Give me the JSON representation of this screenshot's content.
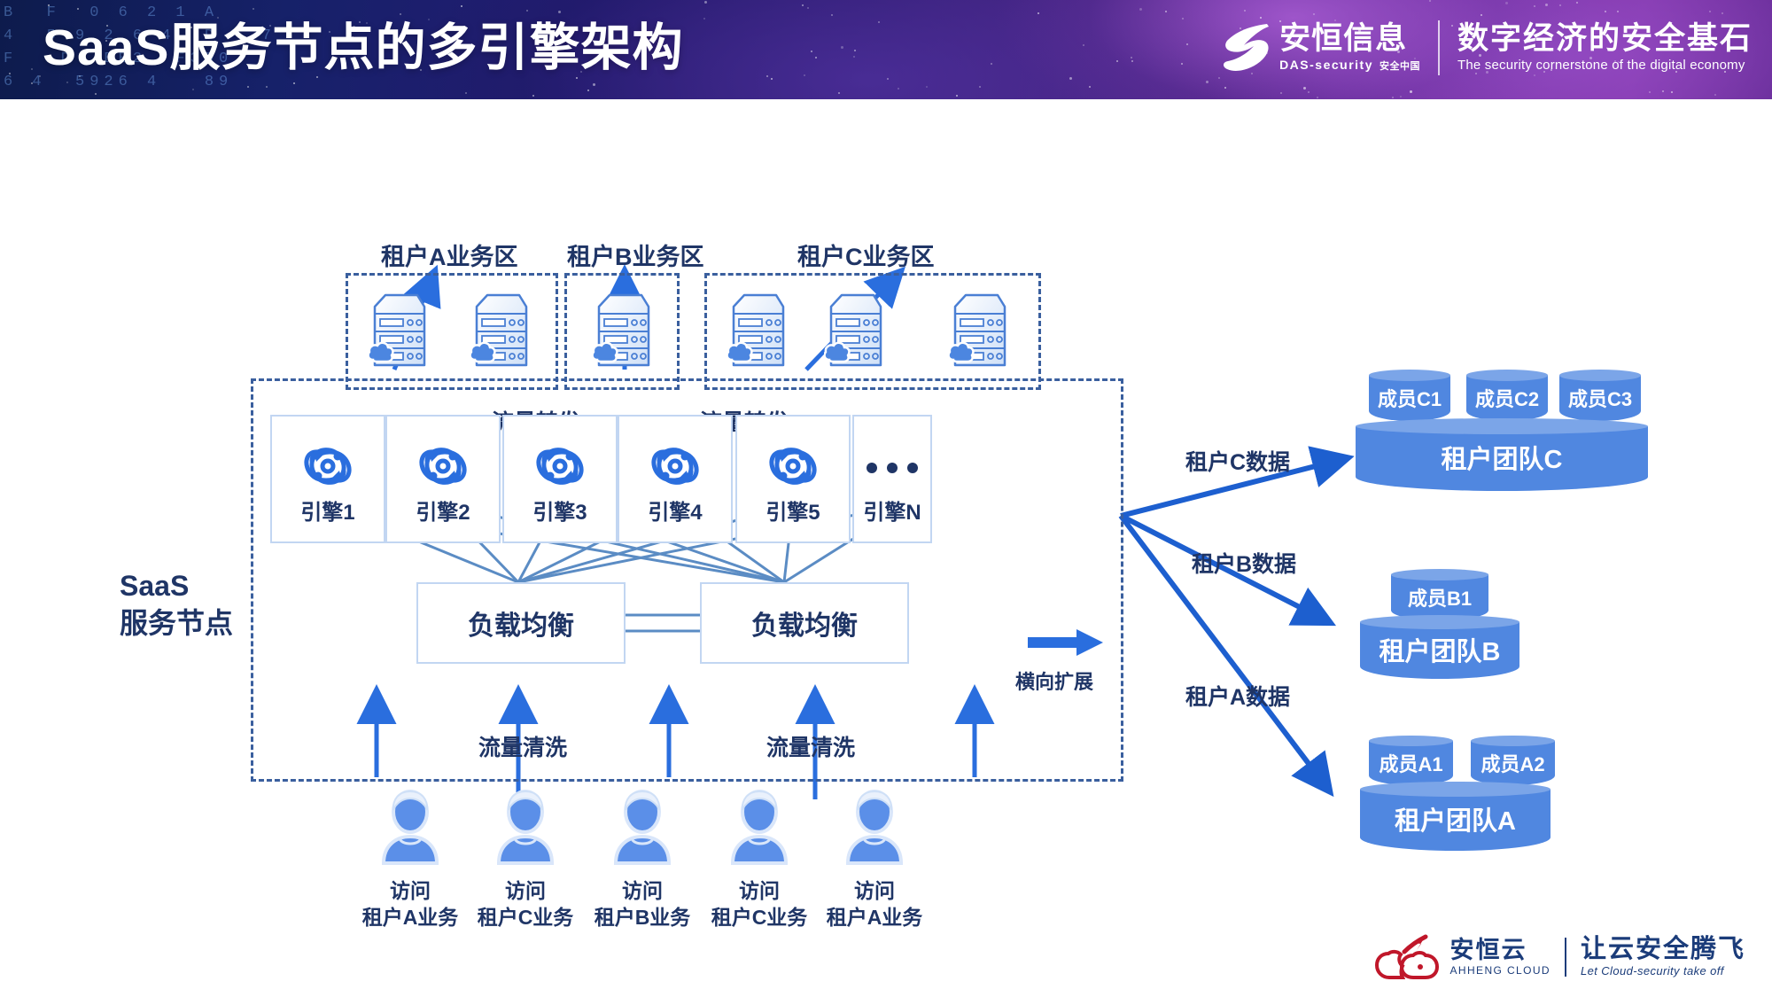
{
  "header": {
    "title": "SaaS服务节点的多引擎架构",
    "code_texts": "B  F  0 6 2 1 A\n4  5 9 2 6 4  D   7\nF   D  BE2  F3D0\n6 4  5926 4   89",
    "brand": {
      "name_cn": "安恒信息",
      "name_en": "DAS-security",
      "name_en_cn": "安全中国",
      "slogan_cn": "数字经济的安全基石",
      "slogan_en": "The security cornerstone of the digital economy"
    },
    "colors": {
      "bg_start": "#0d1b4c",
      "bg_end": "#8e3cb4",
      "title": "#ffffff"
    }
  },
  "diagram": {
    "colors": {
      "navy_text": "#1f3566",
      "arrow_blue": "#2a6ede",
      "engine_icon": "#2a6ede",
      "box_border": "#c2d6f2",
      "dash_border": "#3a5f9e",
      "cylinder_body": "#5087e0",
      "cylinder_top": "#7ba5e8",
      "wire": "#5b8cc4"
    },
    "saas_label_line1": "SaaS",
    "saas_label_line2": "服务节点",
    "tenant_zones": [
      {
        "title": "租户A业务区",
        "servers": 2
      },
      {
        "title": "租户B业务区",
        "servers": 1
      },
      {
        "title": "租户C业务区",
        "servers": 3
      }
    ],
    "forward_labels": [
      "流量转发",
      "流量转发"
    ],
    "engines": [
      {
        "name": "引擎1",
        "icon": "atom-engine-icon"
      },
      {
        "name": "引擎2",
        "icon": "atom-engine-icon"
      },
      {
        "name": "引擎3",
        "icon": "atom-engine-icon"
      },
      {
        "name": "引擎4",
        "icon": "atom-engine-icon"
      },
      {
        "name": "引擎5",
        "icon": "atom-engine-icon"
      },
      {
        "name": "引擎N",
        "icon": "ellipsis-dots-icon"
      }
    ],
    "scale_out_label": "横向扩展",
    "load_balancers": [
      "负载均衡",
      "负载均衡"
    ],
    "clean_labels": [
      "流量清洗",
      "流量清洗"
    ],
    "users": [
      {
        "line1": "访问",
        "line2": "租户A业务"
      },
      {
        "line1": "访问",
        "line2": "租户C业务"
      },
      {
        "line1": "访问",
        "line2": "租户B业务"
      },
      {
        "line1": "访问",
        "line2": "租户C业务"
      },
      {
        "line1": "访问",
        "line2": "租户A业务"
      }
    ],
    "data_labels": [
      "租户C数据",
      "租户B数据",
      "租户A数据"
    ],
    "teams": [
      {
        "name": "租户团队C",
        "members": [
          "成员C1",
          "成员C2",
          "成员C3"
        ]
      },
      {
        "name": "租户团队B",
        "members": [
          "成员B1"
        ]
      },
      {
        "name": "租户团队A",
        "members": [
          "成员A1",
          "成员A2"
        ]
      }
    ]
  },
  "footer": {
    "name_cn": "安恒云",
    "name_en": "AHHENG CLOUD",
    "slogan_cn": "让云安全腾飞",
    "slogan_en": "Let Cloud-security take off"
  }
}
